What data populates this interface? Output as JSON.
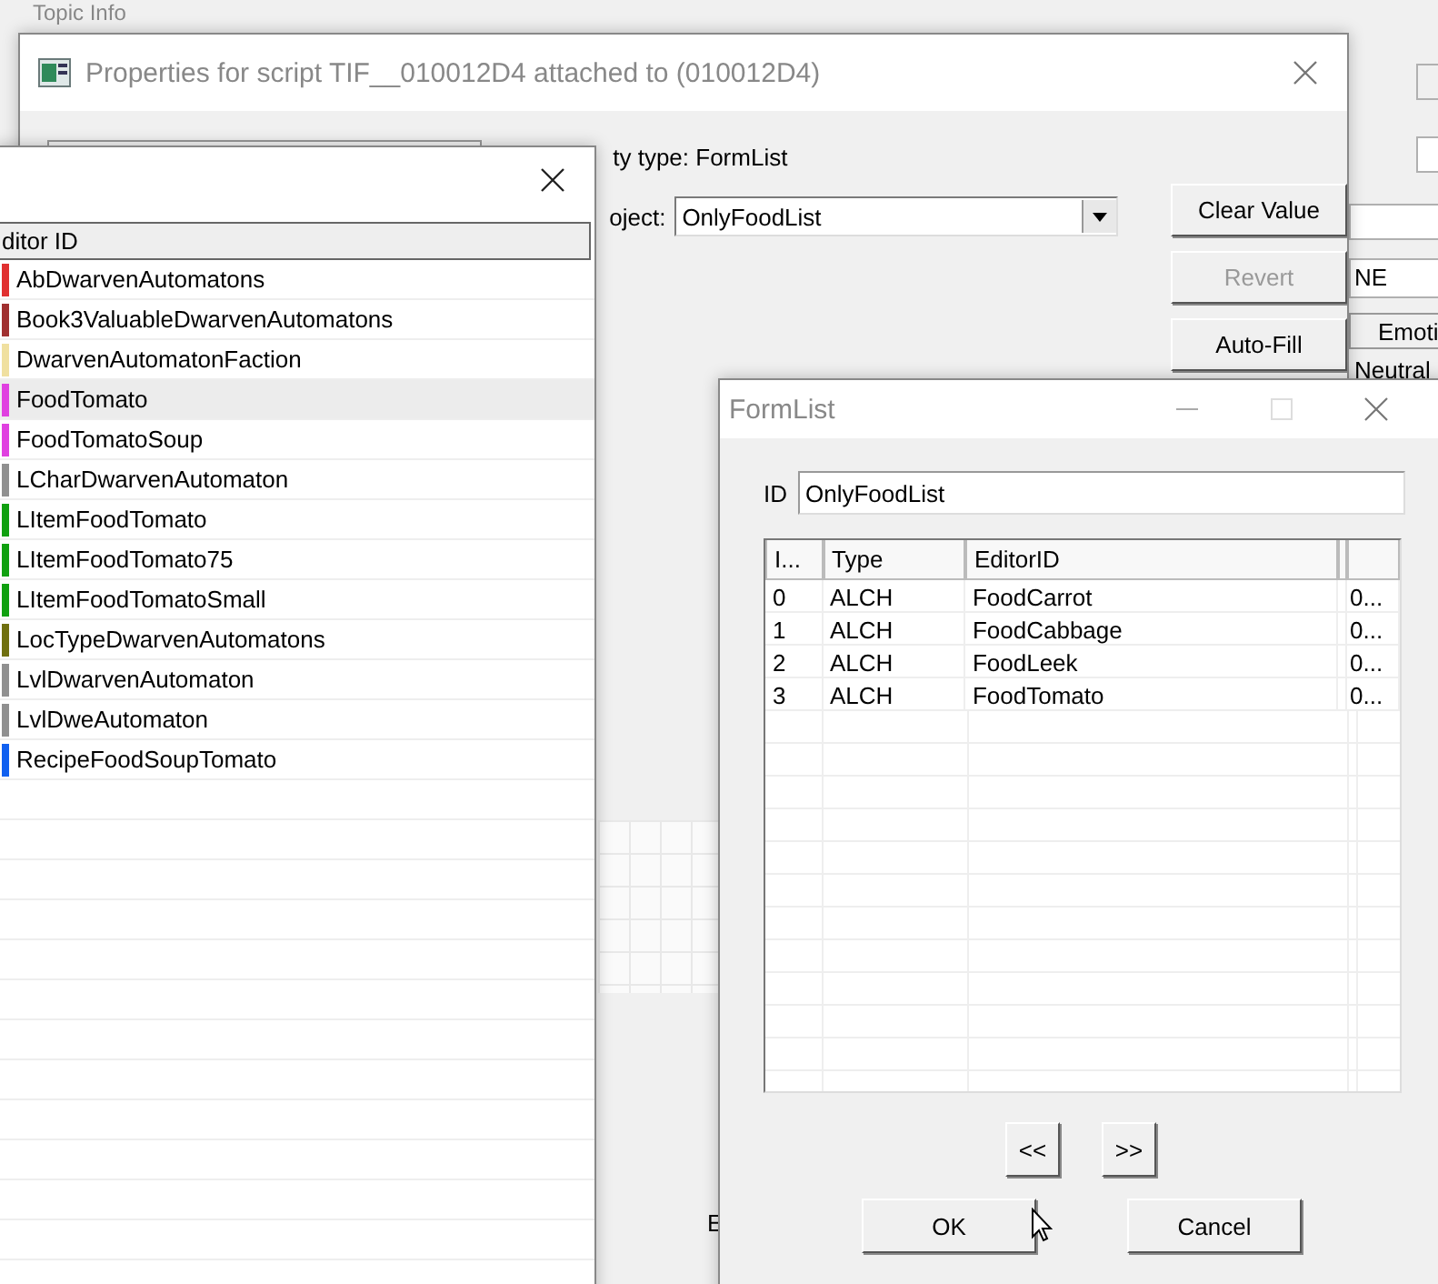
{
  "background_window": {
    "title": "Topic Info",
    "field_text": "NE",
    "column_header": "Emoti",
    "cell": "Neutral"
  },
  "properties_window": {
    "title": "Properties for script TIF__010012D4 attached to  (010012D4)",
    "property_type": "ty type: FormList",
    "object_label": "oject:",
    "object_value": "OnlyFoodList",
    "label_fragment": "E",
    "buttons": [
      {
        "label": "Clear Value",
        "disabled": false
      },
      {
        "label": "Revert",
        "disabled": true
      },
      {
        "label": "Auto-Fill",
        "disabled": false
      }
    ]
  },
  "picker_window": {
    "column": "ditor ID",
    "items": [
      {
        "name": "AbDwarvenAutomatons",
        "color": "#e03030",
        "selected": false
      },
      {
        "name": "Book3ValuableDwarvenAutomatons",
        "color": "#a03030",
        "selected": false
      },
      {
        "name": "DwarvenAutomatonFaction",
        "color": "#f0e0a0",
        "selected": false
      },
      {
        "name": "FoodTomato",
        "color": "#e040e0",
        "selected": true
      },
      {
        "name": "FoodTomatoSoup",
        "color": "#e040e0",
        "selected": false
      },
      {
        "name": "LCharDwarvenAutomaton",
        "color": "#909090",
        "selected": false
      },
      {
        "name": "LItemFoodTomato",
        "color": "#10a010",
        "selected": false
      },
      {
        "name": "LItemFoodTomato75",
        "color": "#10a010",
        "selected": false
      },
      {
        "name": "LItemFoodTomatoSmall",
        "color": "#10a010",
        "selected": false
      },
      {
        "name": "LocTypeDwarvenAutomatons",
        "color": "#707010",
        "selected": false
      },
      {
        "name": "LvlDwarvenAutomaton",
        "color": "#909090",
        "selected": false
      },
      {
        "name": "LvlDweAutomaton",
        "color": "#909090",
        "selected": false
      },
      {
        "name": "RecipeFoodSoupTomato",
        "color": "#1060f0",
        "selected": false
      }
    ]
  },
  "formlist_window": {
    "title": "FormList",
    "id_label": "ID",
    "id_value": "OnlyFoodList",
    "columns": [
      "I...",
      "Type",
      "EditorID"
    ],
    "rows": [
      {
        "index": "0",
        "type": "ALCH",
        "editor_id": "FoodCarrot",
        "extra": "0..."
      },
      {
        "index": "1",
        "type": "ALCH",
        "editor_id": "FoodCabbage",
        "extra": "0..."
      },
      {
        "index": "2",
        "type": "ALCH",
        "editor_id": "FoodLeek",
        "extra": "0..."
      },
      {
        "index": "3",
        "type": "ALCH",
        "editor_id": "FoodTomato",
        "extra": "0..."
      }
    ],
    "nav_buttons": [
      "<<",
      ">>"
    ],
    "buttons": [
      "OK",
      "Cancel"
    ]
  }
}
